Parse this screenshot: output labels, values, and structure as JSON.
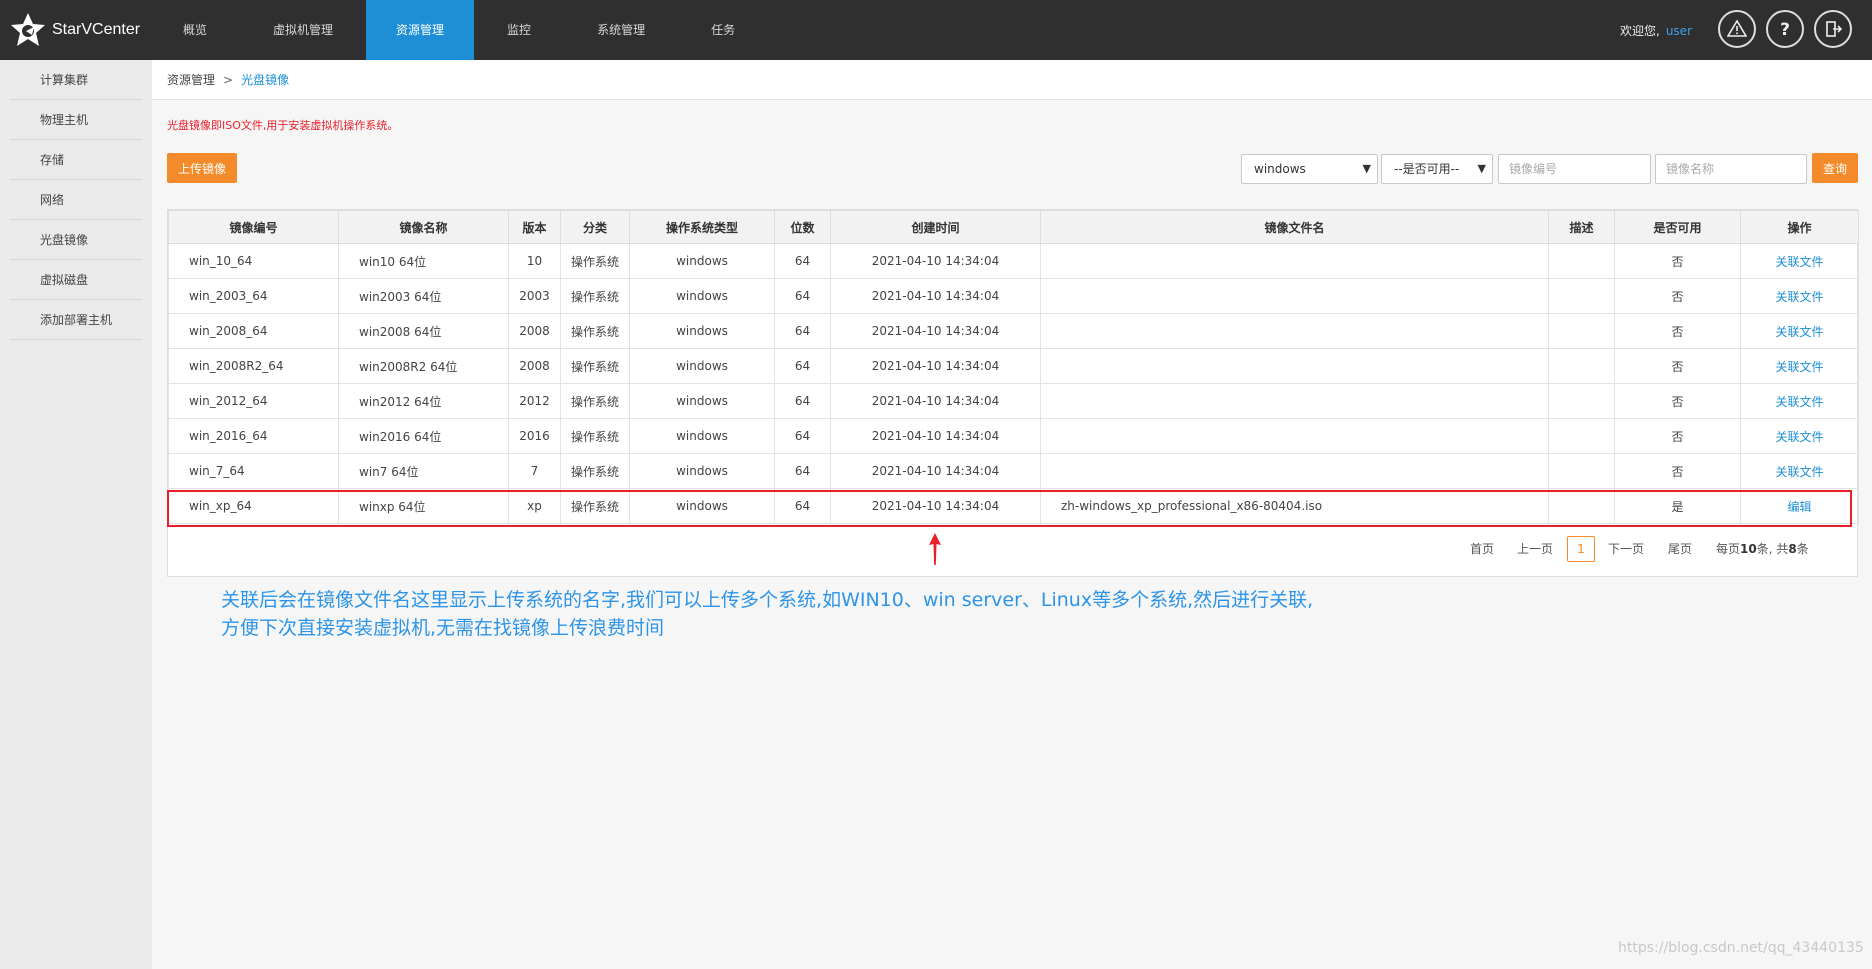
{
  "app": {
    "name": "StarVCenter"
  },
  "nav": [
    {
      "label": "概览"
    },
    {
      "label": "虚拟机管理"
    },
    {
      "label": "资源管理",
      "active": true
    },
    {
      "label": "监控"
    },
    {
      "label": "系统管理"
    },
    {
      "label": "任务"
    }
  ],
  "header": {
    "welcome": "欢迎您,",
    "user": "user",
    "icons": [
      "warning-icon",
      "help-icon",
      "logout-icon"
    ]
  },
  "sidebar": {
    "items": [
      {
        "label": "计算集群"
      },
      {
        "label": "物理主机"
      },
      {
        "label": "存储"
      },
      {
        "label": "网络"
      },
      {
        "label": "光盘镜像"
      },
      {
        "label": "虚拟磁盘"
      },
      {
        "label": "添加部署主机"
      }
    ]
  },
  "breadcrumb": {
    "parent": "资源管理",
    "separator": ">",
    "current": "光盘镜像"
  },
  "notice": "光盘镜像即ISO文件,用于安装虚拟机操作系统。",
  "toolbar": {
    "upload_label": "上传镜像",
    "os_filter_value": "windows",
    "available_filter_value": "--是否可用--",
    "image_id_placeholder": "镜像编号",
    "image_name_placeholder": "镜像名称",
    "query_label": "查询"
  },
  "table": {
    "columns": [
      "镜像编号",
      "镜像名称",
      "版本",
      "分类",
      "操作系统类型",
      "位数",
      "创建时间",
      "镜像文件名",
      "描述",
      "是否可用",
      "操作"
    ],
    "rows": [
      {
        "id": "win_10_64",
        "name": "win10 64位",
        "version": "10",
        "category": "操作系统",
        "os": "windows",
        "bits": "64",
        "created": "2021-04-10 14:34:04",
        "file": "",
        "desc": "",
        "available": "否",
        "action": "关联文件"
      },
      {
        "id": "win_2003_64",
        "name": "win2003 64位",
        "version": "2003",
        "category": "操作系统",
        "os": "windows",
        "bits": "64",
        "created": "2021-04-10 14:34:04",
        "file": "",
        "desc": "",
        "available": "否",
        "action": "关联文件"
      },
      {
        "id": "win_2008_64",
        "name": "win2008 64位",
        "version": "2008",
        "category": "操作系统",
        "os": "windows",
        "bits": "64",
        "created": "2021-04-10 14:34:04",
        "file": "",
        "desc": "",
        "available": "否",
        "action": "关联文件"
      },
      {
        "id": "win_2008R2_64",
        "name": "win2008R2 64位",
        "version": "2008",
        "category": "操作系统",
        "os": "windows",
        "bits": "64",
        "created": "2021-04-10 14:34:04",
        "file": "",
        "desc": "",
        "available": "否",
        "action": "关联文件"
      },
      {
        "id": "win_2012_64",
        "name": "win2012 64位",
        "version": "2012",
        "category": "操作系统",
        "os": "windows",
        "bits": "64",
        "created": "2021-04-10 14:34:04",
        "file": "",
        "desc": "",
        "available": "否",
        "action": "关联文件"
      },
      {
        "id": "win_2016_64",
        "name": "win2016 64位",
        "version": "2016",
        "category": "操作系统",
        "os": "windows",
        "bits": "64",
        "created": "2021-04-10 14:34:04",
        "file": "",
        "desc": "",
        "available": "否",
        "action": "关联文件"
      },
      {
        "id": "win_7_64",
        "name": "win7 64位",
        "version": "7",
        "category": "操作系统",
        "os": "windows",
        "bits": "64",
        "created": "2021-04-10 14:34:04",
        "file": "",
        "desc": "",
        "available": "否",
        "action": "关联文件"
      },
      {
        "id": "win_xp_64",
        "name": "winxp 64位",
        "version": "xp",
        "category": "操作系统",
        "os": "windows",
        "bits": "64",
        "created": "2021-04-10 14:34:04",
        "file": "zh-windows_xp_professional_x86-80404.iso",
        "desc": "",
        "available": "是",
        "action": "编辑"
      }
    ]
  },
  "pagination": {
    "first": "首页",
    "prev": "上一页",
    "current": "1",
    "next": "下一页",
    "last": "尾页",
    "per_page_prefix": "每页",
    "per_page": "10",
    "total_mid": "条, 共",
    "total": "8",
    "total_suffix": "条"
  },
  "annotation": {
    "line1": "关联后会在镜像文件名这里显示上传系统的名字,我们可以上传多个系统,如WIN10、win server、Linux等多个系统,然后进行关联,",
    "line2": "方便下次直接安装虚拟机,无需在找镜像上传浪费时间"
  },
  "watermark": "https://blog.csdn.net/qq_43440135",
  "colors": {
    "accent": "#1e8fd7",
    "orange": "#f38b2b",
    "alert": "#e8202a",
    "topbar": "#2f2f2f"
  }
}
